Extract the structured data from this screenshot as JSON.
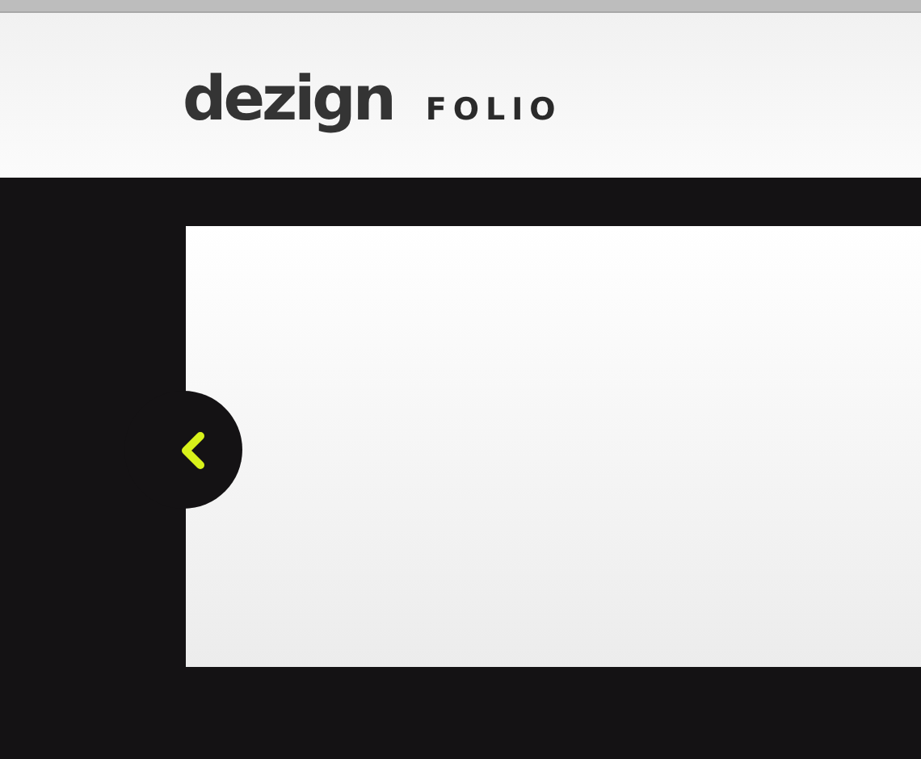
{
  "logo": {
    "name": "dezign",
    "tagline": "FOLIO"
  }
}
